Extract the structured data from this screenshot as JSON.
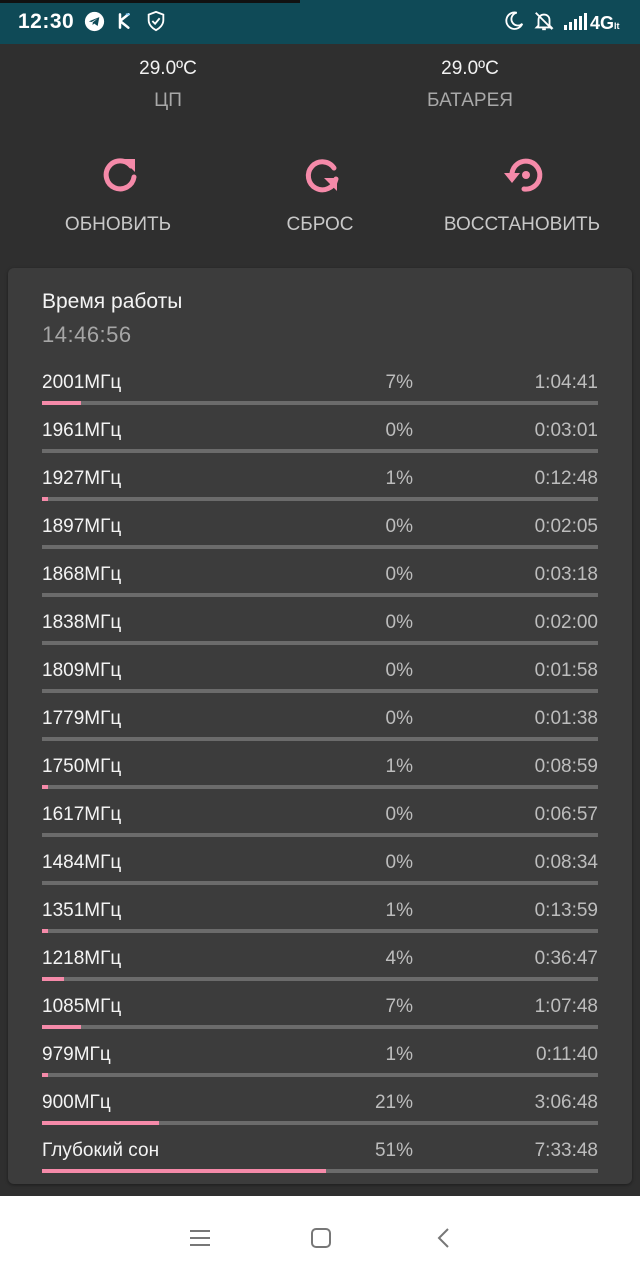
{
  "status_bar": {
    "time": "12:30",
    "network": "4G",
    "network_sub": "lt",
    "icons": [
      "telegram-icon",
      "k-app-icon",
      "shield-check-icon",
      "moon-icon",
      "bell-off-icon",
      "signal-icon"
    ]
  },
  "temps": [
    {
      "value": "29.0ºC",
      "label": "ЦП"
    },
    {
      "value": "29.0ºC",
      "label": "БАТАРЕЯ"
    }
  ],
  "actions": [
    {
      "label": "ОБНОВИТЬ",
      "icon": "refresh-icon"
    },
    {
      "label": "СБРОС",
      "icon": "reset-icon"
    },
    {
      "label": "ВОССТАНОВИТЬ",
      "icon": "restore-icon"
    }
  ],
  "accent_color": "#f58aa9",
  "uptime": {
    "title": "Время работы",
    "value": "14:46:56"
  },
  "freq_rows": [
    {
      "freq": "2001МГц",
      "pct": "7%",
      "time": "1:04:41",
      "fraction": 0.07
    },
    {
      "freq": "1961МГц",
      "pct": "0%",
      "time": "0:03:01",
      "fraction": 0.0
    },
    {
      "freq": "1927МГц",
      "pct": "1%",
      "time": "0:12:48",
      "fraction": 0.01
    },
    {
      "freq": "1897МГц",
      "pct": "0%",
      "time": "0:02:05",
      "fraction": 0.0
    },
    {
      "freq": "1868МГц",
      "pct": "0%",
      "time": "0:03:18",
      "fraction": 0.0
    },
    {
      "freq": "1838МГц",
      "pct": "0%",
      "time": "0:02:00",
      "fraction": 0.0
    },
    {
      "freq": "1809МГц",
      "pct": "0%",
      "time": "0:01:58",
      "fraction": 0.0
    },
    {
      "freq": "1779МГц",
      "pct": "0%",
      "time": "0:01:38",
      "fraction": 0.0
    },
    {
      "freq": "1750МГц",
      "pct": "1%",
      "time": "0:08:59",
      "fraction": 0.01
    },
    {
      "freq": "1617МГц",
      "pct": "0%",
      "time": "0:06:57",
      "fraction": 0.0
    },
    {
      "freq": "1484МГц",
      "pct": "0%",
      "time": "0:08:34",
      "fraction": 0.0
    },
    {
      "freq": "1351МГц",
      "pct": "1%",
      "time": "0:13:59",
      "fraction": 0.01
    },
    {
      "freq": "1218МГц",
      "pct": "4%",
      "time": "0:36:47",
      "fraction": 0.04
    },
    {
      "freq": "1085МГц",
      "pct": "7%",
      "time": "1:07:48",
      "fraction": 0.07
    },
    {
      "freq": "979МГц",
      "pct": "1%",
      "time": "0:11:40",
      "fraction": 0.01
    },
    {
      "freq": "900МГц",
      "pct": "21%",
      "time": "3:06:48",
      "fraction": 0.21
    },
    {
      "freq": "Глубокий сон",
      "pct": "51%",
      "time": "7:33:48",
      "fraction": 0.51
    }
  ],
  "nav_bar": {
    "icons": [
      "menu-icon",
      "home-icon",
      "back-icon"
    ]
  }
}
